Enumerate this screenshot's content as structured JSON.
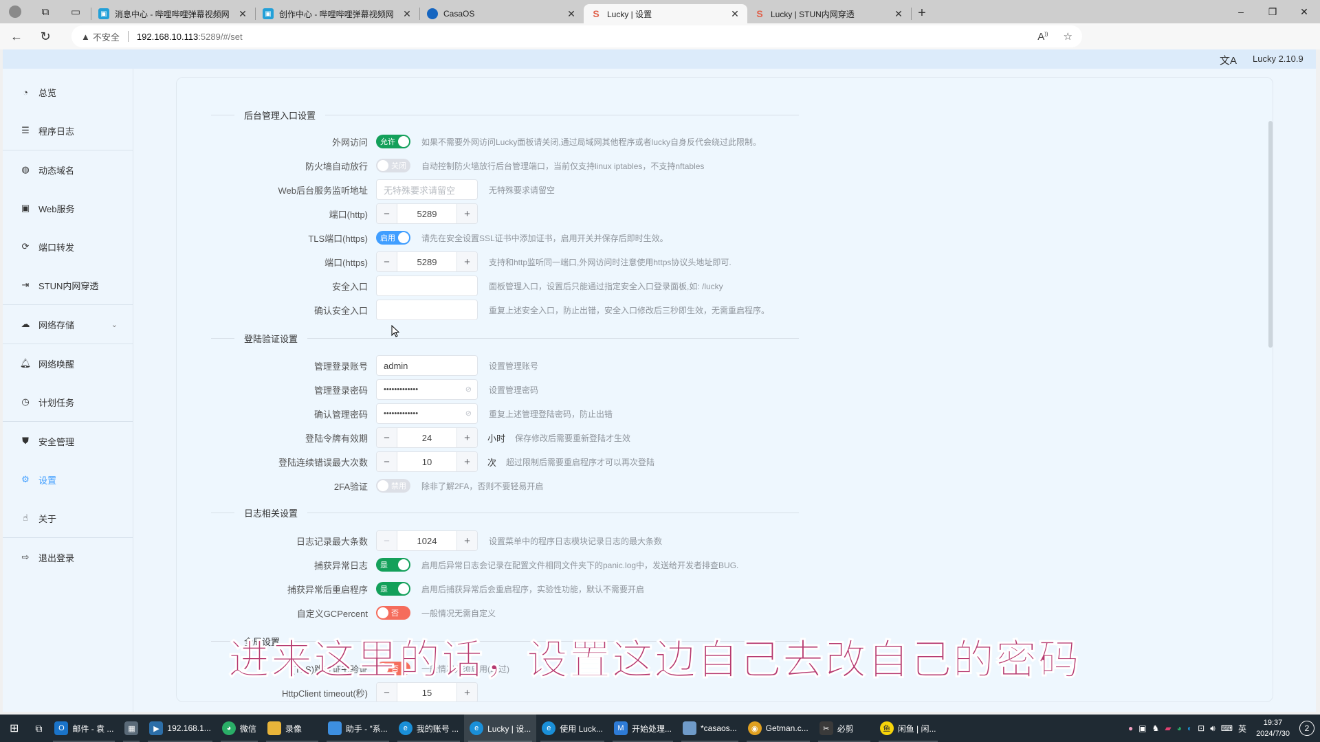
{
  "browser": {
    "tabs": [
      {
        "title": "消息中心 - 哔哩哔哩弹幕视频网",
        "icon": "bilibili-icon",
        "active": false
      },
      {
        "title": "创作中心 - 哔哩哔哩弹幕视频网",
        "icon": "bilibili-icon",
        "active": false
      },
      {
        "title": "CasaOS",
        "icon": "casaos-icon",
        "active": false
      },
      {
        "title": "Lucky | 设置",
        "icon": "lucky-icon",
        "active": true
      },
      {
        "title": "Lucky | STUN内网穿透",
        "icon": "lucky-icon",
        "active": false
      }
    ],
    "new_tab": "+",
    "security_label": "不安全",
    "url_host": "192.168.10.113",
    "url_path": ":5289/#/set",
    "window_controls": {
      "minimize": "–",
      "restore": "❐",
      "close": "✕"
    }
  },
  "app": {
    "version": "Lucky 2.10.9",
    "translate_icon": "文A"
  },
  "sidebar": {
    "items": [
      {
        "label": "总览",
        "icon": "dashboard-icon",
        "glyph": "◔"
      },
      {
        "label": "程序日志",
        "icon": "log-icon",
        "glyph": "☰"
      },
      {
        "label": "动态域名",
        "icon": "dns-icon",
        "glyph": "◍"
      },
      {
        "label": "Web服务",
        "icon": "web-service-icon",
        "glyph": "▣"
      },
      {
        "label": "端口转发",
        "icon": "port-forward-icon",
        "glyph": "⟳"
      },
      {
        "label": "STUN内网穿透",
        "icon": "stun-icon",
        "glyph": "⇥"
      },
      {
        "label": "网络存储",
        "icon": "cloud-storage-icon",
        "glyph": "☁",
        "chevron": "⌄"
      },
      {
        "label": "网络唤醒",
        "icon": "bell-icon",
        "glyph": "🔔︎"
      },
      {
        "label": "计划任务",
        "icon": "clock-icon",
        "glyph": "◷"
      },
      {
        "label": "安全管理",
        "icon": "shield-icon",
        "glyph": "⛊"
      },
      {
        "label": "设置",
        "icon": "gear-icon",
        "glyph": "⚙",
        "active": true
      },
      {
        "label": "关于",
        "icon": "fingerprint-icon",
        "glyph": "☝"
      },
      {
        "label": "退出登录",
        "icon": "logout-icon",
        "glyph": "⇨"
      }
    ]
  },
  "settings": {
    "sections": {
      "admin_entry": "后台管理入口设置",
      "login_auth": "登陆验证设置",
      "log": "日志相关设置",
      "global": "全局设置"
    },
    "external_access": {
      "label": "外网访问",
      "state": "允许",
      "on": true,
      "hint": "如果不需要外网访问Lucky面板请关闭,通过局域网其他程序或者lucky自身反代会绕过此限制。"
    },
    "firewall_auto": {
      "label": "防火墙自动放行",
      "state": "关闭",
      "on": false,
      "hint": "自动控制防火墙放行后台管理端口，当前仅支持linux iptables，不支持nftables"
    },
    "listen_addr": {
      "label": "Web后台服务监听地址",
      "placeholder": "无特殊要求请留空",
      "value": "",
      "hint": "无特殊要求请留空"
    },
    "http_port": {
      "label": "端口(http)",
      "value": "5289"
    },
    "tls_port_toggle": {
      "label": "TLS端口(https)",
      "state": "启用",
      "on": true,
      "hint": "请先在安全设置SSL证书中添加证书，启用开关并保存后即时生效。"
    },
    "https_port": {
      "label": "端口(https)",
      "value": "5289",
      "hint": "支持和http监听同一端口,外网访问时注意使用https协议头地址即可."
    },
    "safe_entry": {
      "label": "安全入口",
      "value": "",
      "hint": "面板管理入口，设置后只能通过指定安全入口登录面板,如: /lucky"
    },
    "safe_entry_confirm": {
      "label": "确认安全入口",
      "value": "",
      "hint": "重复上述安全入口，防止出错，安全入口修改后三秒即生效，无需重启程序。"
    },
    "admin_account": {
      "label": "管理登录账号",
      "value": "admin",
      "hint": "设置管理账号"
    },
    "admin_password": {
      "label": "管理登录密码",
      "value": "•••••••••••••",
      "hint": "设置管理密码"
    },
    "admin_password_confirm": {
      "label": "确认管理密码",
      "value": "•••••••••••••",
      "hint": "重复上述管理登陆密码，防止出错"
    },
    "token_expiry": {
      "label": "登陆令牌有效期",
      "value": "24",
      "unit": "小时",
      "hint": "保存修改后需要重新登陆才生效"
    },
    "max_login_errors": {
      "label": "登陆连续错误最大次数",
      "value": "10",
      "unit": "次",
      "hint": "超过限制后需要重启程序才可以再次登陆"
    },
    "twofa": {
      "label": "2FA验证",
      "state": "禁用",
      "on": false,
      "hint": "除非了解2FA，否则不要轻易开启"
    },
    "log_max": {
      "label": "日志记录最大条数",
      "value": "1024",
      "hint": "设置菜单中的程序日志模块记录日志的最大条数"
    },
    "capture_panic_log": {
      "label": "捕获异常日志",
      "state": "是",
      "on": true,
      "hint": "启用后异常日志会记录在配置文件相同文件夹下的panic.log中，发送给开发者排查BUG."
    },
    "restart_on_panic": {
      "label": "捕获异常后重启程序",
      "state": "是",
      "on": true,
      "hint": "启用后捕获异常后会重启程序，实验性功能，默认不需要开启"
    },
    "custom_gc": {
      "label": "自定义GCPercent",
      "state": "否",
      "on": false,
      "hint": "一般情况无需自定义"
    },
    "tls_skip_verify": {
      "label": "(TLS)跳过证书验证",
      "state": "否",
      "on": false,
      "hint": "一般情况无须启用(跳过)"
    },
    "http_timeout": {
      "label": "HttpClient timeout(秒)",
      "value": "15"
    },
    "stepper_minus": "−",
    "stepper_plus": "+",
    "eye_off": "⊘"
  },
  "subtitle": "进来这里的话，设置这边自己去改自己的密码",
  "taskbar": {
    "items": [
      {
        "label": "邮件 - 袁 ...",
        "icon": "outlook-icon",
        "color": "#1a73c8"
      },
      {
        "label": "",
        "icon": "calculator-icon",
        "color": "#5a6a78"
      },
      {
        "label": "192.168.1...",
        "icon": "remote-desktop-icon",
        "color": "#2c6ea8"
      },
      {
        "label": "微信",
        "icon": "wechat-icon",
        "color": "#2aae67"
      },
      {
        "label": "录像",
        "icon": "folder-icon",
        "color": "#e8b43a"
      },
      {
        "label": "助手 - \"系...",
        "icon": "assistant-icon",
        "color": "#3d8fe0"
      },
      {
        "label": "我的账号 ...",
        "icon": "edge-icon",
        "color": "#1a8fd8"
      },
      {
        "label": "Lucky | 设...",
        "icon": "edge-icon",
        "color": "#1a8fd8",
        "active": true
      },
      {
        "label": "使用 Luck...",
        "icon": "edge-icon",
        "color": "#1a8fd8"
      },
      {
        "label": "开始处理...",
        "icon": "app-m-icon",
        "color": "#2e7bd6"
      },
      {
        "label": "*casaos...",
        "icon": "notepad-icon",
        "color": "#6f9bc9"
      },
      {
        "label": "Getman.c...",
        "icon": "chrome-icon",
        "color": "#e0a020"
      },
      {
        "label": "必剪",
        "icon": "bijian-icon",
        "color": "#3a3a3a"
      },
      {
        "label": "闲鱼 | 闲...",
        "icon": "xianyu-icon",
        "color": "#f6d40a"
      }
    ],
    "ime": "英",
    "time": "19:37",
    "date": "2024/7/30",
    "notifications": "2"
  }
}
